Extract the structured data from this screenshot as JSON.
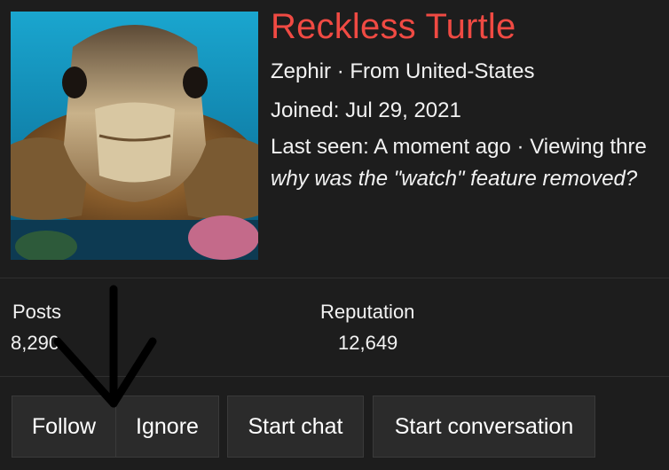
{
  "profile": {
    "username": "Reckless Turtle",
    "user_title": "Zephir",
    "location_prefix": "From",
    "location": "United-States",
    "joined_label": "Joined:",
    "joined_date": "Jul 29, 2021",
    "last_seen_label": "Last seen:",
    "last_seen_value": "A moment ago",
    "activity": "Viewing thre",
    "activity_thread": "why was the \"watch\" feature removed?",
    "avatar_icon": "turtle-avatar-photo"
  },
  "stats": {
    "posts_label": "Posts",
    "posts_value": "8,290",
    "reputation_label": "Reputation",
    "reputation_value": "12,649"
  },
  "actions": {
    "follow": "Follow",
    "ignore": "Ignore",
    "start_chat": "Start chat",
    "start_conversation": "Start conversation"
  },
  "overlay": {
    "icon": "down-arrow-annotation"
  },
  "colors": {
    "username": "#f04a43",
    "background": "#1d1d1d",
    "button_bg": "#2b2b2b"
  }
}
